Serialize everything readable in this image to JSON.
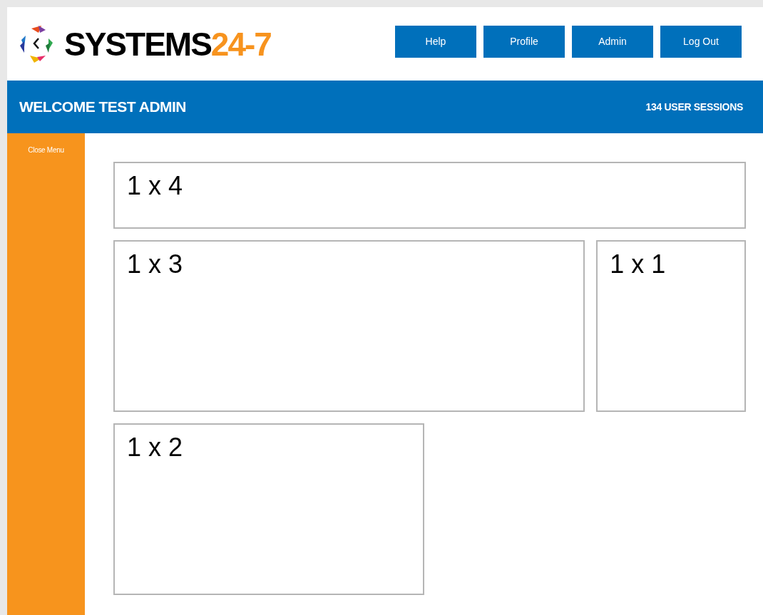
{
  "logo": {
    "name": "SYSTEMS",
    "suffix": "24-7"
  },
  "nav_buttons": [
    "Help",
    "Profile",
    "Admin",
    "Log Out"
  ],
  "welcome_bar": {
    "greeting": "WELCOME TEST ADMIN",
    "sessions": "134 USER SESSIONS"
  },
  "sidebar": {
    "toggle": "Close Menu"
  },
  "panels": [
    {
      "label": "1 x 4"
    },
    {
      "label": "1 x 3"
    },
    {
      "label": "1 x 1"
    },
    {
      "label": "1 x 2"
    }
  ]
}
